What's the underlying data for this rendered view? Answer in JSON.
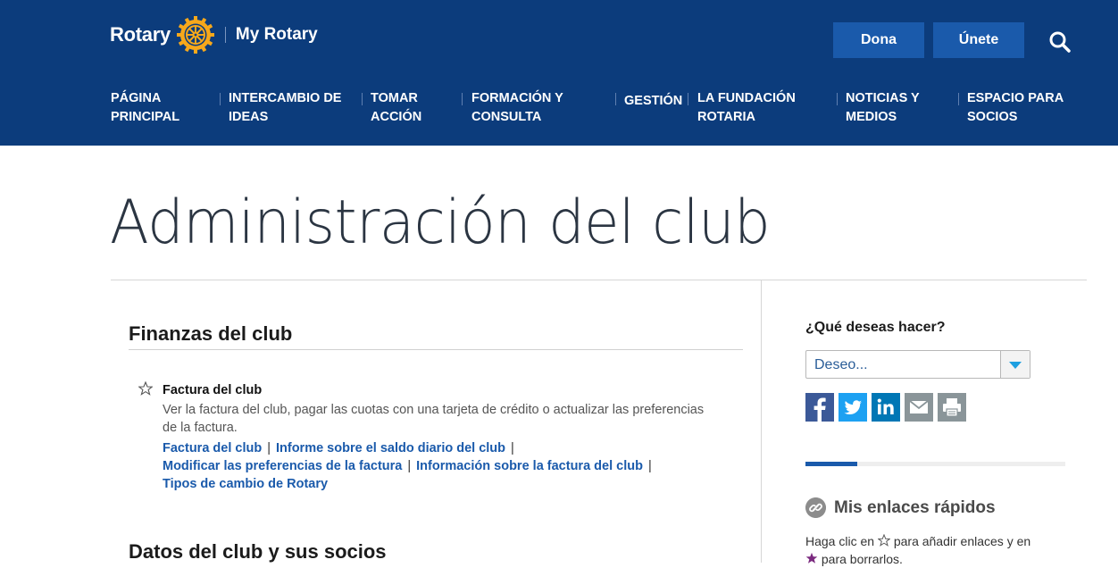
{
  "header": {
    "brand": "Rotary",
    "site_name": "My Rotary",
    "donate_label": "Dona",
    "join_label": "Únete",
    "nav": [
      {
        "line1": "PÁGINA",
        "line2": "PRINCIPAL"
      },
      {
        "line1": "INTERCAMBIO DE",
        "line2": "IDEAS"
      },
      {
        "line1": "TOMAR",
        "line2": "ACCIÓN"
      },
      {
        "line1": "FORMACIÓN Y",
        "line2": "CONSULTA"
      },
      {
        "line1": "GESTIÓN",
        "line2": ""
      },
      {
        "line1": "LA FUNDACIÓN",
        "line2": "ROTARIA"
      },
      {
        "line1": "NOTICIAS Y",
        "line2": "MEDIOS"
      },
      {
        "line1": "ESPACIO PARA",
        "line2": "SOCIOS"
      }
    ]
  },
  "page": {
    "title": "Administración del club"
  },
  "main": {
    "section1_title": "Finanzas del club",
    "item": {
      "title": "Factura del club",
      "description": "Ver la factura del club, pagar las cuotas con una tarjeta de crédito o actualizar las preferencias de la factura.",
      "links": [
        "Factura del club",
        "Informe sobre el saldo diario del club",
        "Modificar las preferencias de la factura",
        "Información sobre la factura del club",
        "Tipos de cambio de Rotary"
      ]
    },
    "section2_title": "Datos del club y sus socios"
  },
  "aside": {
    "question": "¿Qué deseas hacer?",
    "select_value": "Deseo...",
    "progress_fraction": 0.2,
    "quick_links_title": "Mis enlaces rápidos",
    "quick_links_text_a": "Haga clic en",
    "quick_links_text_b": "para añadir enlaces y en",
    "quick_links_text_c": "para borrarlos."
  },
  "colors": {
    "header_bg": "#0c3c7c",
    "button_bg": "#1a5aab",
    "link": "#1a5aab",
    "rotary_gold": "#f7a81b",
    "facebook": "#3b5998",
    "twitter": "#1da1f2",
    "linkedin": "#0077b5",
    "share_gray": "#8a9599",
    "fav_star": "#7b2a7f"
  },
  "icons": {
    "logo": "rotary-wheel-icon",
    "search": "search-icon",
    "favorite": "star-outline-icon",
    "dropdown": "chevron-down-icon",
    "share": [
      "facebook-icon",
      "twitter-icon",
      "linkedin-icon",
      "email-icon",
      "print-icon"
    ],
    "quick_links": "link-icon"
  }
}
